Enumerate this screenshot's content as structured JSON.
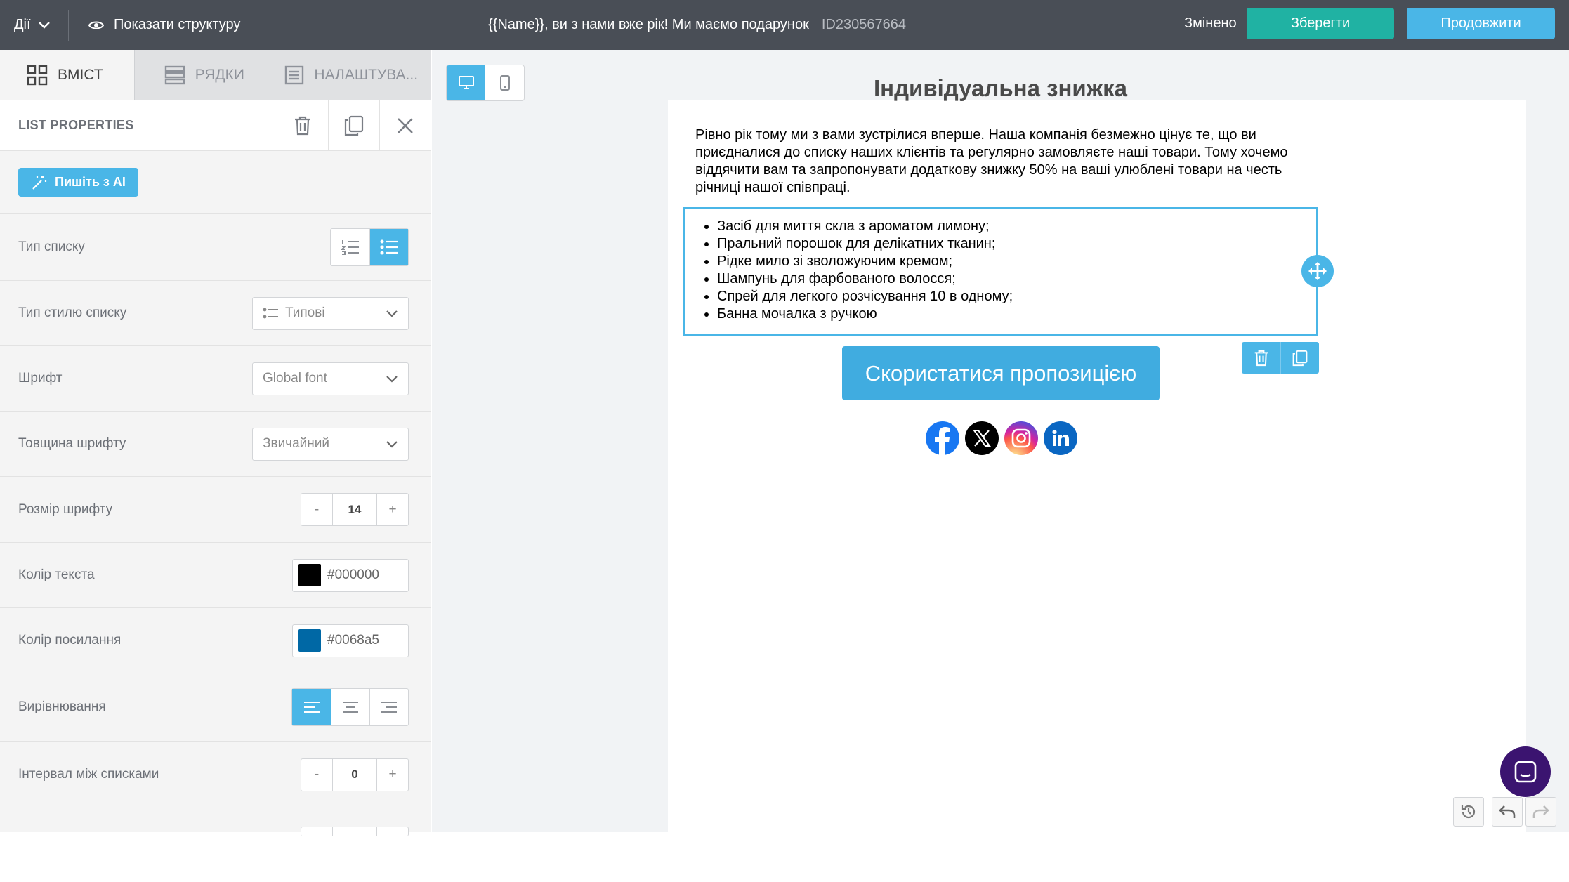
{
  "topbar": {
    "actions_label": "Дії",
    "show_structure": "Показати структуру",
    "email_subject": "{{Name}}, ви з нами вже рік! Ми маємо подарунок",
    "email_id": "ID230567664",
    "status": "Змінено",
    "save_label": "Зберегти",
    "continue_label": "Продовжити"
  },
  "sidebar": {
    "tabs": [
      {
        "label": "ВМІСТ",
        "icon": "grid-icon"
      },
      {
        "label": "РЯДКИ",
        "icon": "rows-icon"
      },
      {
        "label": "НАЛАШТУВА...",
        "icon": "settings-doc-icon"
      }
    ],
    "panel_title": "LIST PROPERTIES",
    "ai_button": "Пишіть з AI",
    "list_type_label": "Тип списку",
    "list_style_label": "Тип стилю списку",
    "list_style_value": "Типові",
    "font_label": "Шрифт",
    "font_value": "Global font",
    "weight_label": "Товщина шрифту",
    "weight_value": "Звичайний",
    "size_label": "Розмір шрифту",
    "size_value": "14",
    "minus": "-",
    "plus": "+",
    "text_color_label": "Колір текста",
    "text_color_value": "#000000",
    "link_color_label": "Колір посилання",
    "link_color_value": "#0068a5",
    "align_label": "Вирівнювання",
    "spacing_label": "Інтервал між списками",
    "spacing_value": "0"
  },
  "email": {
    "heading": "Індивідуальна знижка",
    "paragraph": "Рівно рік тому ми з вами зустрілися вперше. Наша компанія безмежно цінує те, що ви приєдналися до списку наших клієнтів та регулярно замовляєте наші товари. Тому хочемо віддячити вам та запропонувати додаткову знижку 50% на ваші улюблені товари на честь річниці нашої співпраці.",
    "list_items": [
      "Засіб для миття скла з ароматом лимону;",
      "Пральний порошок для делікатних тканин;",
      "Рідке мило зі зволожуючим кремом;",
      "Шампунь для фарбованого волосся;",
      "Спрей для легкого розчісування 10 в одному;",
      "Банна мочалка з ручкою"
    ],
    "cta": "Скористатися пропозицією",
    "social": [
      "facebook-icon",
      "x-icon",
      "instagram-icon",
      "linkedin-icon"
    ]
  },
  "colors": {
    "accent": "#4ab6e7",
    "save": "#20b2a3",
    "topbar": "#494e56",
    "chat": "#3b1470"
  }
}
